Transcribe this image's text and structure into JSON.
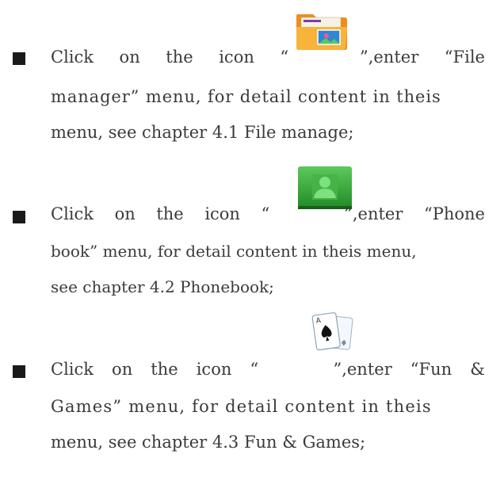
{
  "items": [
    {
      "icon": "file-manager-folder-icon",
      "line1_words": [
        "Click",
        "on",
        "the",
        "icon",
        "“",
        "”,enter",
        "“File"
      ],
      "line2": "manager” menu, for detail content in theis",
      "line3": "menu, see chapter 4.1 File manage;"
    },
    {
      "icon": "phonebook-contact-icon",
      "line1_words": [
        "Click",
        "on",
        "the",
        "icon",
        "“",
        "”,enter",
        "“Phone"
      ],
      "line2": "book” menu, for detail content in theis menu,",
      "line3": "see chapter 4.2 Phonebook;"
    },
    {
      "icon": "playing-cards-icon",
      "line1_words": [
        "Click",
        "on",
        "the",
        "icon",
        "“",
        "”,enter",
        "“Fun",
        "&"
      ],
      "line2": "Games” menu, for detail content in theis",
      "line3": "menu, see chapter 4.3 Fun & Games;"
    }
  ],
  "colors": {
    "text": "#3a3a3a",
    "bullet": "#1a1a1a",
    "folder_orange": "#f4a629",
    "folder_image_blue": "#3c8fd8",
    "phonebook_green": "#3daa3d"
  }
}
